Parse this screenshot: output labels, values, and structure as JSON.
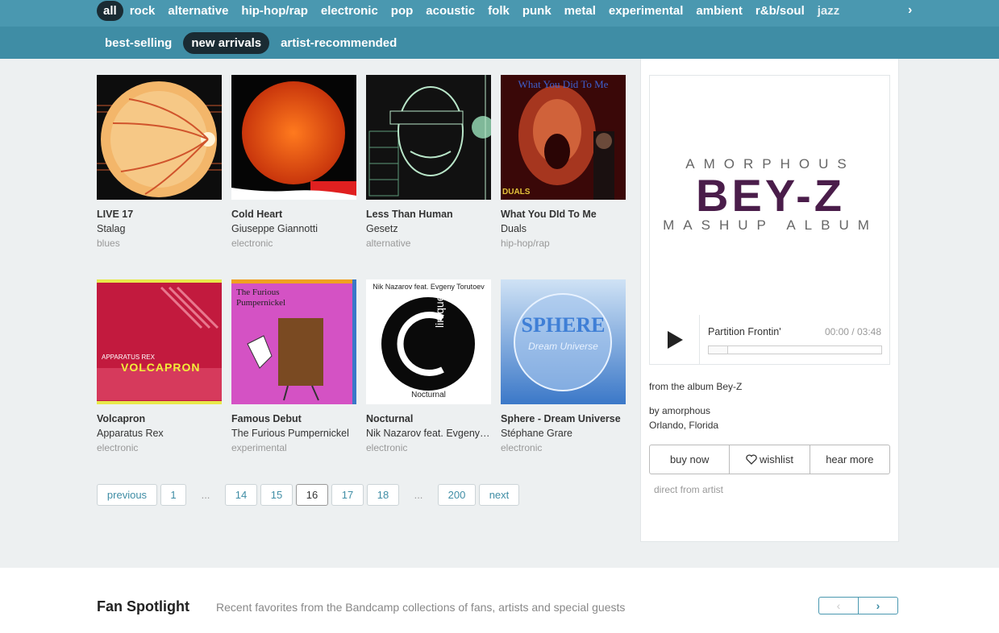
{
  "genres": [
    "all",
    "rock",
    "alternative",
    "hip-hop/rap",
    "electronic",
    "pop",
    "acoustic",
    "folk",
    "punk",
    "metal",
    "experimental",
    "ambient",
    "r&b/soul",
    "jazz"
  ],
  "genre_next": "›",
  "sub_tabs": [
    "best-selling",
    "new arrivals",
    "artist-recommended"
  ],
  "albums": [
    {
      "title": "LIVE 17",
      "artist": "Stalag",
      "genre": "blues"
    },
    {
      "title": "Cold Heart",
      "artist": "Giuseppe Giannotti",
      "genre": "electronic"
    },
    {
      "title": "Less Than Human",
      "artist": "Gesetz",
      "genre": "alternative"
    },
    {
      "title": "What You DId To Me",
      "artist": "Duals",
      "genre": "hip-hop/rap"
    },
    {
      "title": "Volcapron",
      "artist": "Apparatus Rex",
      "genre": "electronic"
    },
    {
      "title": "Famous Debut",
      "artist": "The Furious Pumpernickel",
      "genre": "experimental"
    },
    {
      "title": "Nocturnal",
      "artist": "Nik Nazarov feat. Evgeny Torutoev",
      "genre": "electronic"
    },
    {
      "title": "Sphere - Dream Universe",
      "artist": "Stéphane Grare",
      "genre": "electronic"
    }
  ],
  "art_text": {
    "a2": "What You Did To Me",
    "a2_label": "DUALS",
    "a4": "APPARATUS REX",
    "a4b": "VOLCAPRON",
    "a5": "The Furious Pumpernickel",
    "a6": "Nik Nazarov feat. Evgeny Torutoev",
    "a6b": "linique",
    "a6c": "Nocturnal",
    "a7": "SPHERE",
    "a7b": "Dream Universe"
  },
  "pager": {
    "previous": "previous",
    "p1": "1",
    "dots1": "...",
    "p14": "14",
    "p15": "15",
    "p16": "16",
    "p17": "17",
    "p18": "18",
    "dots2": "...",
    "p200": "200",
    "next": "next"
  },
  "featured": {
    "cover_top": "AMORPHOUS",
    "cover_main": "BEY-Z",
    "cover_bottom": "MASHUP ALBUM",
    "track": "Partition Frontin'",
    "time": "00:00 / 03:48",
    "progress": 0.0,
    "from": "from the album Bey-Z",
    "by": "by amorphous",
    "location": "Orlando, Florida",
    "buy": "buy now",
    "wishlist": "wishlist",
    "hear_more": "hear more",
    "direct": "direct from artist"
  },
  "spotlight": {
    "heading": "Fan Spotlight",
    "desc": "Recent favorites from the Bandcamp collections of fans, artists and special guests",
    "prev": "‹",
    "next": "›"
  }
}
